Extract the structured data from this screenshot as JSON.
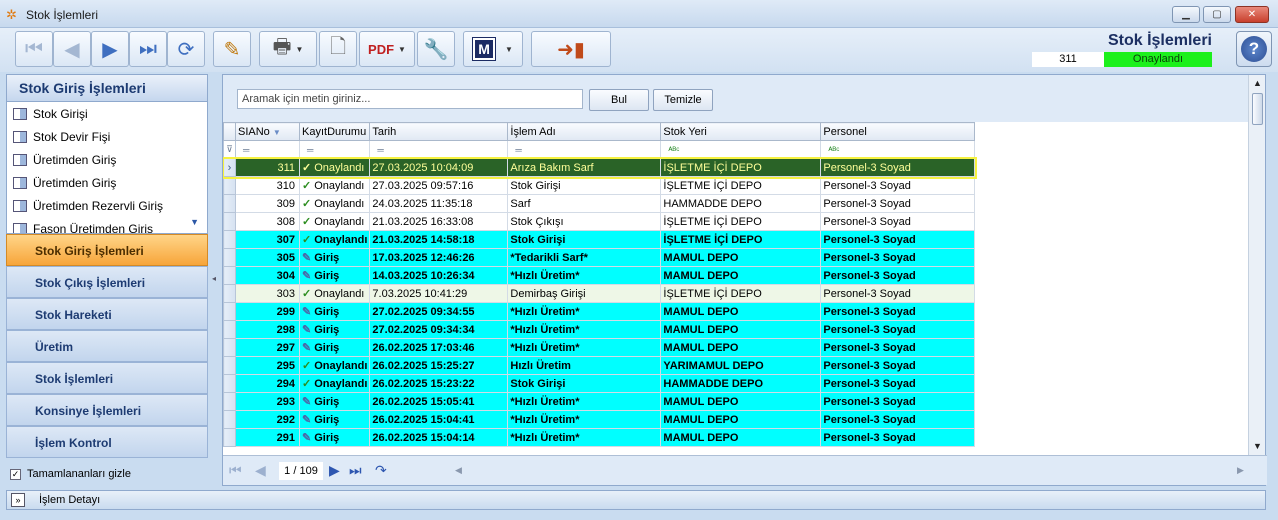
{
  "window": {
    "title": "Stok İşlemleri"
  },
  "toolbar": {
    "buttons": [
      "first-record",
      "previous-record",
      "next-record",
      "last-record",
      "refresh",
      "edit",
      "print",
      "new-document",
      "pdf-save",
      "tools",
      "m-menu",
      "exit"
    ]
  },
  "header": {
    "title": "Stok İşlemleri",
    "record_no": "311",
    "status": "Onaylandı"
  },
  "left": {
    "title": "Stok Giriş İşlemleri",
    "items": [
      "Stok Girişi",
      "Stok Devir Fişi",
      "Üretimden Giriş",
      "Üretimden Giriş",
      "Üretimden Rezervli Giriş",
      "Fason Üretimden Giriş"
    ],
    "groups": [
      "Stok Giriş İşlemleri",
      "Stok Çıkış İşlemleri",
      "Stok Hareketi",
      "Üretim",
      "Stok İşlemleri",
      "Konsinye İşlemleri",
      "İşlem Kontrol"
    ],
    "hide_completed": "Tamamlananları gizle"
  },
  "search": {
    "placeholder": "Aramak için metin giriniz...",
    "find": "Bul",
    "clear": "Temizle"
  },
  "grid": {
    "columns": [
      "SIANo",
      "KayıtDurumu",
      "Tarih",
      "İşlem Adı",
      "Stok Yeri",
      "Personel"
    ],
    "rows": [
      {
        "no": "311",
        "status": "Onaylandı",
        "date": "27.03.2025 10:04:09",
        "op": "Arıza Bakım Sarf",
        "loc": "İŞLETME İÇİ DEPO",
        "person": "Personel-3 Soyad"
      },
      {
        "no": "310",
        "status": "Onaylandı",
        "date": "27.03.2025 09:57:16",
        "op": "Stok Girişi",
        "loc": "İŞLETME İÇİ DEPO",
        "person": "Personel-3 Soyad"
      },
      {
        "no": "309",
        "status": "Onaylandı",
        "date": "24.03.2025 11:35:18",
        "op": "Sarf",
        "loc": "HAMMADDE DEPO",
        "person": "Personel-3 Soyad"
      },
      {
        "no": "308",
        "status": "Onaylandı",
        "date": "21.03.2025 16:33:08",
        "op": "Stok Çıkışı",
        "loc": "İŞLETME İÇİ DEPO",
        "person": "Personel-3 Soyad"
      },
      {
        "no": "307",
        "status": "Onaylandı",
        "date": "21.03.2025 14:58:18",
        "op": "Stok Girişi",
        "loc": "İŞLETME İÇİ DEPO",
        "person": "Personel-3 Soyad"
      },
      {
        "no": "305",
        "status": "Giriş",
        "date": "17.03.2025 12:46:26",
        "op": "*Tedarikli Sarf*",
        "loc": "MAMUL DEPO",
        "person": "Personel-3 Soyad"
      },
      {
        "no": "304",
        "status": "Giriş",
        "date": "14.03.2025 10:26:34",
        "op": "*Hızlı Üretim*",
        "loc": "MAMUL DEPO",
        "person": "Personel-3 Soyad"
      },
      {
        "no": "303",
        "status": "Onaylandı",
        "date": "7.03.2025 10:41:29",
        "op": "Demirbaş Girişi",
        "loc": "İŞLETME İÇİ DEPO",
        "person": "Personel-3 Soyad"
      },
      {
        "no": "299",
        "status": "Giriş",
        "date": "27.02.2025 09:34:55",
        "op": "*Hızlı Üretim*",
        "loc": "MAMUL DEPO",
        "person": "Personel-3 Soyad"
      },
      {
        "no": "298",
        "status": "Giriş",
        "date": "27.02.2025 09:34:34",
        "op": "*Hızlı Üretim*",
        "loc": "MAMUL DEPO",
        "person": "Personel-3 Soyad"
      },
      {
        "no": "297",
        "status": "Giriş",
        "date": "26.02.2025 17:03:46",
        "op": "*Hızlı Üretim*",
        "loc": "MAMUL DEPO",
        "person": "Personel-3 Soyad"
      },
      {
        "no": "295",
        "status": "Onaylandı",
        "date": "26.02.2025 15:25:27",
        "op": "Hızlı Üretim",
        "loc": "YARIMAMUL DEPO",
        "person": "Personel-3 Soyad"
      },
      {
        "no": "294",
        "status": "Onaylandı",
        "date": "26.02.2025 15:23:22",
        "op": "Stok Girişi",
        "loc": "HAMMADDE DEPO",
        "person": "Personel-3 Soyad"
      },
      {
        "no": "293",
        "status": "Giriş",
        "date": "26.02.2025 15:05:41",
        "op": "*Hızlı Üretim*",
        "loc": "MAMUL DEPO",
        "person": "Personel-3 Soyad"
      },
      {
        "no": "292",
        "status": "Giriş",
        "date": "26.02.2025 15:04:41",
        "op": "*Hızlı Üretim*",
        "loc": "MAMUL DEPO",
        "person": "Personel-3 Soyad"
      },
      {
        "no": "291",
        "status": "Giriş",
        "date": "26.02.2025 15:04:14",
        "op": "*Hızlı Üretim*",
        "loc": "MAMUL DEPO",
        "person": "Personel-3 Soyad"
      }
    ]
  },
  "pager": {
    "page": "1 / 109"
  },
  "bottom": {
    "label": "İşlem Detayı"
  }
}
